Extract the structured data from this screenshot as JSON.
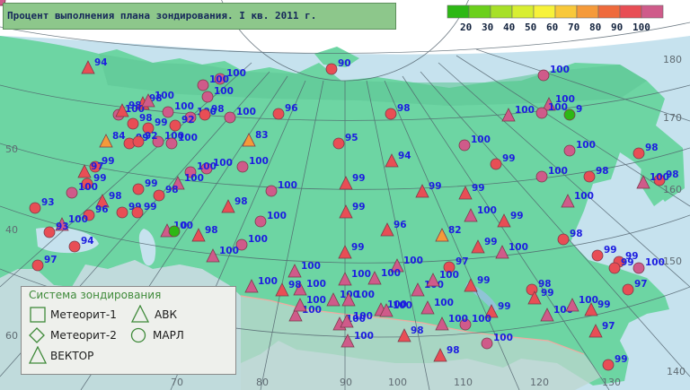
{
  "title": "Процент выполнения плана зондирования. I кв. 2011 г.",
  "scale": {
    "labels": [
      "20",
      "30",
      "40",
      "50",
      "60",
      "70",
      "80",
      "90",
      "100"
    ],
    "colors": [
      "#2db814",
      "#6bd01c",
      "#a7e028",
      "#d8ee32",
      "#f7f23a",
      "#f8c83a",
      "#f59a3a",
      "#ef6a3c",
      "#e84e55",
      "#cf5b8a"
    ]
  },
  "legend": {
    "title": "Система зондирования",
    "items": [
      {
        "symbol": "square",
        "label": "Метеорит-1"
      },
      {
        "symbol": "triangle",
        "label": "АВК"
      },
      {
        "symbol": "diamond",
        "label": "Метеорит-2"
      },
      {
        "symbol": "circle",
        "label": "МАРЛ"
      },
      {
        "symbol": "triangle",
        "label": "ВЕКТОР"
      }
    ]
  },
  "graticule": {
    "left_labels": [
      "50",
      "40"
    ],
    "right_labels": [
      "180",
      "170",
      "160",
      "150",
      "140"
    ],
    "bottom_labels": [
      "60",
      "70",
      "80",
      "90",
      "100",
      "110",
      "120",
      "130"
    ]
  },
  "stations": [
    {
      "t": "triangle",
      "v": "94"
    },
    {
      "t": "circle",
      "v": "90"
    },
    {
      "t": "circle",
      "v": "100"
    },
    {
      "t": "circle",
      "v": "100"
    },
    {
      "t": "circle",
      "v": "100"
    },
    {
      "t": "triangle",
      "v": "98"
    },
    {
      "t": "circle",
      "v": "100"
    },
    {
      "t": "triangle",
      "v": "100"
    },
    {
      "t": "circle",
      "v": "100"
    },
    {
      "t": "circle",
      "v": "100"
    },
    {
      "t": "circle",
      "v": "99"
    },
    {
      "t": "circle",
      "v": "98"
    },
    {
      "t": "circle",
      "v": "100"
    },
    {
      "t": "circle",
      "v": "92"
    },
    {
      "t": "circle",
      "v": "98"
    },
    {
      "t": "circle",
      "v": "98"
    },
    {
      "t": "circle",
      "v": "96"
    },
    {
      "t": "circle",
      "v": "99"
    },
    {
      "t": "circle",
      "v": "100"
    },
    {
      "t": "triangle",
      "v": "100"
    },
    {
      "t": "circle",
      "v": "100"
    },
    {
      "t": "triangle",
      "v": "100"
    },
    {
      "t": "circle",
      "v": "9"
    },
    {
      "t": "triangle",
      "v": "98"
    },
    {
      "t": "circle",
      "v": "100"
    },
    {
      "t": "triangle",
      "v": "84"
    },
    {
      "t": "circle",
      "v": "92"
    },
    {
      "t": "circle",
      "v": "100"
    },
    {
      "t": "triangle",
      "v": "83"
    },
    {
      "t": "circle",
      "v": "95"
    },
    {
      "t": "circle",
      "v": "100"
    },
    {
      "t": "circle",
      "v": "98"
    },
    {
      "t": "triangle",
      "v": "94"
    },
    {
      "t": "circle",
      "v": "99"
    },
    {
      "t": "circle",
      "v": "100"
    },
    {
      "t": "circle",
      "v": "100"
    },
    {
      "t": "circle",
      "v": "100"
    },
    {
      "t": "triangle",
      "v": "97"
    },
    {
      "t": "circle",
      "v": "98"
    },
    {
      "t": "circle",
      "v": "99"
    },
    {
      "t": "circle",
      "v": "100"
    },
    {
      "t": "triangle",
      "v": "100"
    },
    {
      "t": "circle",
      "v": "98"
    },
    {
      "t": "triangle",
      "v": "99"
    },
    {
      "t": "circle",
      "v": "100"
    },
    {
      "t": "circle",
      "v": "100"
    },
    {
      "t": "circle",
      "v": "99"
    },
    {
      "t": "triangle",
      "v": "99"
    },
    {
      "t": "circle",
      "v": "99"
    },
    {
      "t": "triangle",
      "v": "98"
    },
    {
      "t": "circle",
      "v": "100"
    },
    {
      "t": "triangle",
      "v": "100"
    },
    {
      "t": "circle",
      "v": "98"
    },
    {
      "t": "circle",
      "v": "93"
    },
    {
      "t": "circle",
      "v": "96"
    },
    {
      "t": "circle",
      "v": "99"
    },
    {
      "t": "triangle",
      "v": "100"
    },
    {
      "t": "circle",
      "v": "99"
    },
    {
      "t": "triangle",
      "v": "98"
    },
    {
      "t": "triangle",
      "v": "99"
    },
    {
      "t": "triangle",
      "v": "100"
    },
    {
      "t": "triangle",
      "v": "99"
    },
    {
      "t": "triangle",
      "v": "100"
    },
    {
      "t": "circle",
      "v": "100"
    },
    {
      "t": "triangle",
      "v": "99"
    },
    {
      "t": "triangle",
      "v": "98"
    },
    {
      "t": "circle",
      "v": "93"
    },
    {
      "t": "triangle",
      "v": "99"
    },
    {
      "t": "triangle",
      "v": "100"
    },
    {
      "t": "circle",
      "v": "94"
    },
    {
      "t": "circle",
      "v": "97"
    },
    {
      "t": "triangle",
      "v": "99"
    },
    {
      "t": "circle",
      "v": "100"
    },
    {
      "t": "triangle",
      "v": "96"
    },
    {
      "t": "triangle",
      "v": "82"
    },
    {
      "t": "circle",
      "v": "98"
    },
    {
      "t": "circle",
      "v": "0"
    },
    {
      "t": "circle",
      "v": "99"
    },
    {
      "t": "circle",
      "v": "99"
    },
    {
      "t": "triangle",
      "v": "100"
    },
    {
      "t": "triangle",
      "v": "100"
    },
    {
      "t": "triangle",
      "v": "100"
    },
    {
      "t": "triangle",
      "v": "100"
    },
    {
      "t": "circle",
      "v": "100"
    },
    {
      "t": "circle",
      "v": "99"
    },
    {
      "t": "triangle",
      "v": "100"
    },
    {
      "t": "circle",
      "v": "97"
    },
    {
      "t": "circle",
      "v": "97"
    },
    {
      "t": "triangle",
      "v": "100"
    },
    {
      "t": "triangle",
      "v": "100"
    },
    {
      "t": "triangle",
      "v": "100"
    },
    {
      "t": "triangle",
      "v": "100"
    },
    {
      "t": "triangle",
      "v": "99"
    },
    {
      "t": "triangle",
      "v": "100"
    },
    {
      "t": "triangle",
      "v": "100"
    },
    {
      "t": "triangle",
      "v": "99"
    },
    {
      "t": "triangle",
      "v": "100"
    },
    {
      "t": "circle",
      "v": "100"
    },
    {
      "t": "circle",
      "v": "98"
    },
    {
      "t": "triangle",
      "v": "100"
    },
    {
      "t": "triangle",
      "v": "100"
    },
    {
      "t": "triangle",
      "v": "100"
    },
    {
      "t": "triangle",
      "v": "99"
    },
    {
      "t": "triangle",
      "v": "100"
    },
    {
      "t": "triangle",
      "v": "100"
    },
    {
      "t": "triangle",
      "v": "99"
    },
    {
      "t": "triangle",
      "v": "98"
    },
    {
      "t": "circle",
      "v": "100"
    },
    {
      "t": "triangle",
      "v": "100"
    },
    {
      "t": "triangle",
      "v": "98"
    },
    {
      "t": "triangle",
      "v": "100"
    },
    {
      "t": "triangle",
      "v": "100"
    },
    {
      "t": "triangle",
      "v": "100"
    },
    {
      "t": "triangle",
      "v": "97"
    },
    {
      "t": "triangle",
      "v": "100"
    },
    {
      "t": "triangle",
      "v": "100"
    },
    {
      "t": "triangle",
      "v": "98"
    },
    {
      "t": "circle",
      "v": "99"
    },
    {
      "t": "triangle",
      "v": "100"
    },
    {
      "t": "triangle",
      "v": "99"
    },
    {
      "t": "triangle",
      "v": "100"
    },
    {
      "t": "circle",
      "v": "100"
    }
  ]
}
